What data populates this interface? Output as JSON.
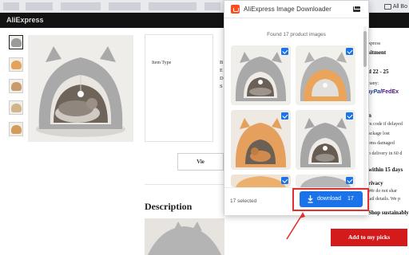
{
  "site": {
    "logo": "AliExpress"
  },
  "browser": {
    "bookmark_label": "All Bo"
  },
  "product": {
    "item_type_label": "Item Type",
    "item_letters": [
      "B",
      "E",
      "D",
      "S"
    ],
    "view_label": "Vie",
    "description_title": "Description"
  },
  "right_column": {
    "lines": [
      "xpress",
      "sitment",
      "d 22 - 25",
      "pany:",
      "FedEx",
      "n",
      "m code if delayed",
      "ackage lost",
      "ems damaged",
      "o delivery in 60 d",
      "within 15 days",
      "rivacy",
      "We do not shar",
      "tail details. We p",
      "Shop sustainably"
    ],
    "paypal": "PayPal",
    "fedex": "FedEx",
    "add_button": "Add to my picks"
  },
  "popup": {
    "title": "AliExpress Image Downloader",
    "found_text": "Found 17 product images",
    "selected_text": "17 selected",
    "download_label": "download",
    "download_count": "17"
  },
  "colors": {
    "accent": "#1a73e8",
    "brand": "#ff4a1c",
    "header": "#131313",
    "add_button": "#d41b1b",
    "highlight": "#e0302f"
  }
}
